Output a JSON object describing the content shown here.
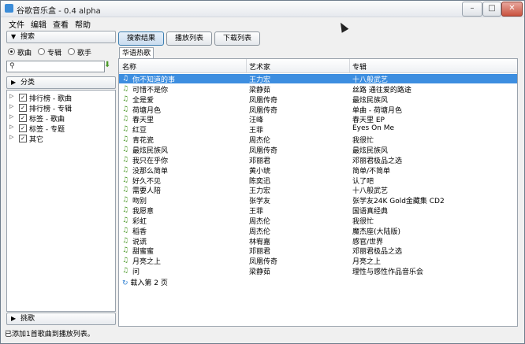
{
  "window": {
    "title": "谷歌音乐盒 - 0.4 alpha",
    "minimize": "–",
    "maximize": "□",
    "close": "✕"
  },
  "menu": [
    "文件",
    "编辑",
    "查看",
    "帮助"
  ],
  "left": {
    "search_tab": "搜索",
    "radios": [
      {
        "label": "歌曲",
        "selected": true
      },
      {
        "label": "专辑",
        "selected": false
      },
      {
        "label": "歌手",
        "selected": false
      }
    ],
    "search_value": "",
    "category_tab": "分类",
    "tree": [
      {
        "label": "排行榜 - 歌曲",
        "checked": true
      },
      {
        "label": "排行榜 - 专辑",
        "checked": true
      },
      {
        "label": "标签 - 歌曲",
        "checked": true
      },
      {
        "label": "标签 - 专题",
        "checked": true
      },
      {
        "label": "其它",
        "checked": true
      }
    ],
    "pick_tab": "挑歌"
  },
  "toolbar": [
    "搜索结果",
    "播放列表",
    "下载列表"
  ],
  "subtab": "华语热歌",
  "table": {
    "headers": [
      "名称",
      "艺术家",
      "专辑"
    ],
    "rows": [
      [
        "你不知道的事",
        "王力宏",
        "十八般武艺"
      ],
      [
        "可惜不是你",
        "梁静茹",
        "丝路 通往爱的路途"
      ],
      [
        "全是爱",
        "凤凰传奇",
        "最炫民族风"
      ],
      [
        "荷塘月色",
        "凤凰传奇",
        "单曲 - 荷塘月色"
      ],
      [
        "春天里",
        "汪峰",
        "春天里 EP"
      ],
      [
        "红豆",
        "王菲",
        "Eyes On Me"
      ],
      [
        "青花瓷",
        "周杰伦",
        "我很忙"
      ],
      [
        "最炫民族风",
        "凤凰传奇",
        "最炫民族风"
      ],
      [
        "我只在乎你",
        "邓丽君",
        "邓丽君极品之选"
      ],
      [
        "没那么简单",
        "黄小琥",
        "简单/不简单"
      ],
      [
        "好久不见",
        "陈奕迅",
        "认了吧"
      ],
      [
        "需要人陪",
        "王力宏",
        "十八般武艺"
      ],
      [
        "吻别",
        "张学友",
        "张学友24K Gold金藏集 CD2"
      ],
      [
        "我愿意",
        "王菲",
        "国语真经典"
      ],
      [
        "彩虹",
        "周杰伦",
        "我很忙"
      ],
      [
        "稻香",
        "周杰伦",
        "魔杰座(大陆版)"
      ],
      [
        "说谎",
        "林宥嘉",
        "感官/世界"
      ],
      [
        "甜蜜蜜",
        "邓丽君",
        "邓丽君极品之选"
      ],
      [
        "月亮之上",
        "凤凰传奇",
        "月亮之上"
      ],
      [
        "问",
        "梁静茹",
        "理性与感性作品音乐会"
      ]
    ],
    "selected_index": 0,
    "load_more": "载入第 2 页"
  },
  "status": "已添加1首歌曲到播放列表。",
  "colors": {
    "selection": "#3d8ee0",
    "note_icon": "#4c9a2a"
  },
  "icons": {
    "note": "music-note-icon",
    "search": "search-icon",
    "download": "download-icon",
    "refresh": "refresh-icon"
  }
}
